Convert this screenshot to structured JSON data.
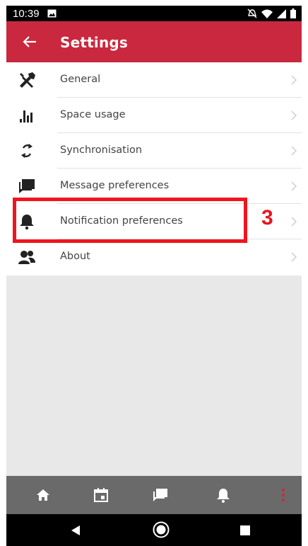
{
  "status_bar": {
    "time": "10:39"
  },
  "header": {
    "title": "Settings"
  },
  "settings": {
    "items": [
      {
        "label": "General"
      },
      {
        "label": "Space usage"
      },
      {
        "label": "Synchronisation"
      },
      {
        "label": "Message preferences"
      },
      {
        "label": "Notification preferences"
      },
      {
        "label": "About"
      }
    ]
  },
  "annotation": {
    "step": "3"
  },
  "colors": {
    "accent": "#c9283e",
    "highlight": "#f0141e"
  }
}
